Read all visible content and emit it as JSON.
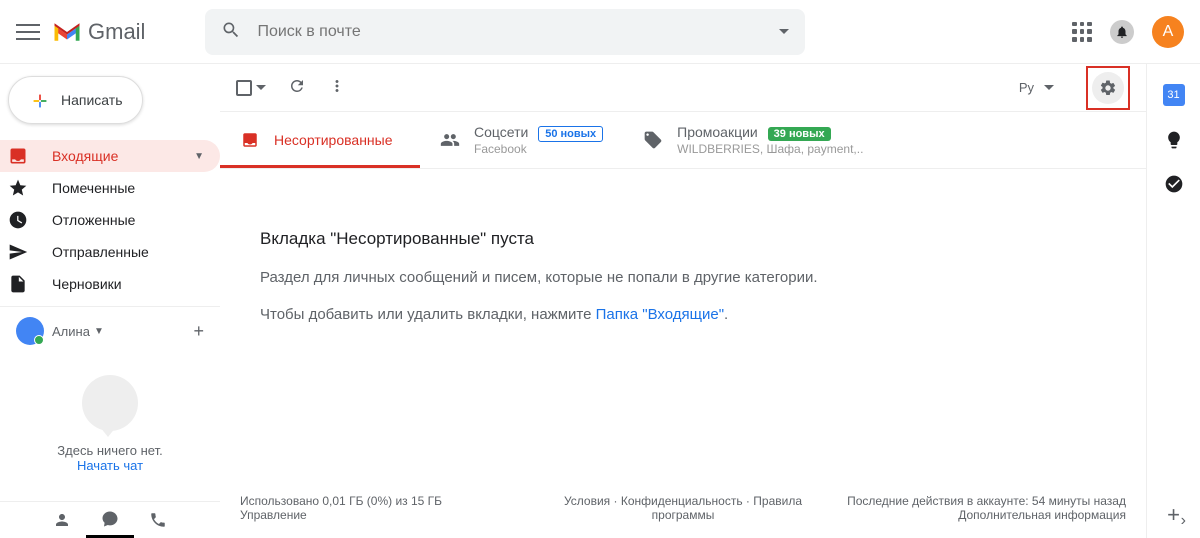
{
  "header": {
    "product": "Gmail",
    "search_placeholder": "Поиск в почте",
    "avatar_letter": "А"
  },
  "sidebar": {
    "compose_label": "Написать",
    "items": [
      {
        "label": "Входящие"
      },
      {
        "label": "Помеченные"
      },
      {
        "label": "Отложенные"
      },
      {
        "label": "Отправленные"
      },
      {
        "label": "Черновики"
      }
    ],
    "user_name": "Алина",
    "hangouts_empty": "Здесь ничего нет.",
    "hangouts_link": "Начать чат"
  },
  "toolbar": {
    "lang": "Ру"
  },
  "tabs": {
    "primary": {
      "label": "Несортированные"
    },
    "social": {
      "label": "Соцсети",
      "badge": "50 новых",
      "sub": "Facebook"
    },
    "promo": {
      "label": "Промоакции",
      "badge": "39 новых",
      "sub": "WILDBERRIES, Шафа, payment,.."
    }
  },
  "empty": {
    "title": "Вкладка \"Несортированные\" пуста",
    "sub1": "Раздел для личных сообщений и писем, которые не попали в другие категории.",
    "sub2": "Чтобы добавить или удалить вкладки, нажмите ",
    "link": "Папка \"Входящие\"",
    "link_suffix": "."
  },
  "footer": {
    "storage": "Использовано 0,01 ГБ (0%) из 15 ГБ",
    "manage": "Управление",
    "terms": "Условия",
    "privacy": "Конфиденциальность",
    "rules": "Правила программы",
    "activity": "Последние действия в аккаунте: 54 минуты назад",
    "details": "Дополнительная информация"
  }
}
